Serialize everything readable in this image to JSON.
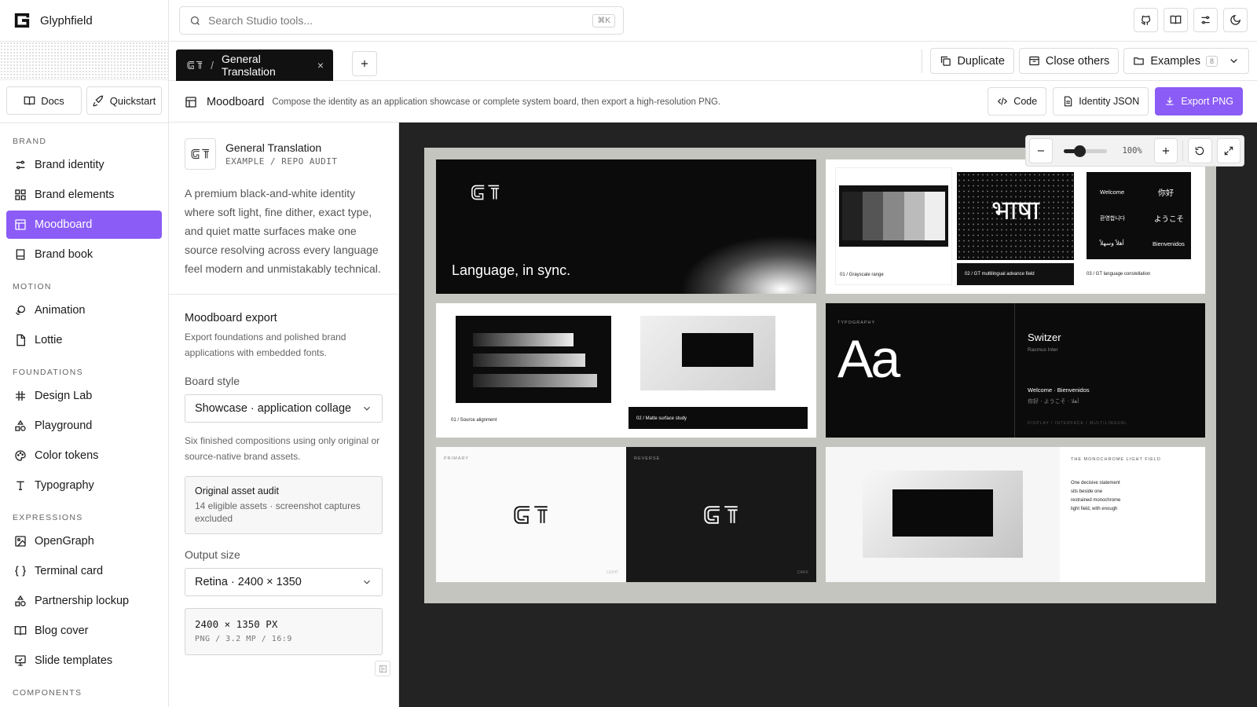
{
  "app": {
    "name": "Glyphfield"
  },
  "search": {
    "placeholder": "Search Studio tools...",
    "shortcut": "⌘K"
  },
  "sidebar": {
    "buttons": [
      {
        "label": "Docs",
        "icon": "book-icon"
      },
      {
        "label": "Quickstart",
        "icon": "rocket-icon"
      }
    ],
    "sections": [
      {
        "title": "BRAND",
        "items": [
          {
            "label": "Brand identity",
            "icon": "sliders-icon"
          },
          {
            "label": "Brand elements",
            "icon": "grid-icon"
          },
          {
            "label": "Moodboard",
            "icon": "layout-icon",
            "active": true
          },
          {
            "label": "Brand book",
            "icon": "book-icon"
          }
        ]
      },
      {
        "title": "MOTION",
        "items": [
          {
            "label": "Animation",
            "icon": "animation-icon"
          },
          {
            "label": "Lottie",
            "icon": "file-icon"
          }
        ]
      },
      {
        "title": "FOUNDATIONS",
        "items": [
          {
            "label": "Design Lab",
            "icon": "hash-icon"
          },
          {
            "label": "Playground",
            "icon": "shapes-icon"
          },
          {
            "label": "Color tokens",
            "icon": "palette-icon"
          },
          {
            "label": "Typography",
            "icon": "type-icon"
          }
        ]
      },
      {
        "title": "EXPRESSIONS",
        "items": [
          {
            "label": "OpenGraph",
            "icon": "image-icon"
          },
          {
            "label": "Terminal card",
            "icon": "braces-icon"
          },
          {
            "label": "Partnership lockup",
            "icon": "shapes-icon"
          },
          {
            "label": "Blog cover",
            "icon": "book-open-icon"
          },
          {
            "label": "Slide templates",
            "icon": "presentation-icon"
          }
        ]
      },
      {
        "title": "COMPONENTS",
        "items": []
      }
    ]
  },
  "tabs": {
    "active": {
      "prefix": "/",
      "label": "General Translation",
      "close": "×"
    }
  },
  "tab_actions": {
    "duplicate": "Duplicate",
    "close_others": "Close others",
    "examples": "Examples",
    "examples_count": "8"
  },
  "page": {
    "title": "Moodboard",
    "description": "Compose the identity as an application showcase or complete system board, then export a high-resolution PNG.",
    "buttons": {
      "code": "Code",
      "identity_json": "Identity JSON",
      "export": "Export PNG"
    }
  },
  "panel": {
    "project_name": "General Translation",
    "project_sub": "EXAMPLE / REPO AUDIT",
    "project_desc": "A premium black-and-white identity where soft light, fine dither, exact type, and quiet matte surfaces make one source resolving across every language feel modern and unmistakably technical.",
    "export_title": "Moodboard export",
    "export_desc": "Export foundations and polished brand applications with embedded fonts.",
    "board_style_label": "Board style",
    "board_style_value": "Showcase · application collage",
    "board_style_hint": "Six finished compositions using only original or source-native brand assets.",
    "audit_title": "Original asset audit",
    "audit_text": "14 eligible assets · screenshot captures excluded",
    "output_label": "Output size",
    "output_value": "Retina · 2400 × 1350",
    "output_dims": "2400 × 1350 PX",
    "output_meta": "PNG / 3.2 MP / 16:9"
  },
  "zoom": {
    "label": "100%",
    "level": 0.35
  },
  "board": {
    "hero": {
      "tagline": "Language, in sync."
    },
    "captions": {
      "grayscale": "01 / Grayscale range",
      "multilingual": "02 / GT multilingual advance field",
      "constellation": "03 / GT language constellation",
      "source": "01 / Source alignment",
      "matte": "02 / Matte surface study"
    },
    "devanagari": "भाषा",
    "greetings": [
      "Welcome",
      "你好",
      "환영합니다",
      "ようこそ",
      "أهلاً وسهلاً",
      "Bienvenidos"
    ],
    "typography": {
      "label": "TYPOGRAPHY",
      "specimen": "Aa",
      "font": "Switzer",
      "font_sub": "Rasmus Inter",
      "sample1": "Welcome · Bienvenidos",
      "sample2": "你好 · ようこそ · أهلا",
      "footer": "DISPLAY / INTERFACE / MULTILINGUAL"
    },
    "primary": {
      "label": "PRIMARY",
      "tag": "LIGHT"
    },
    "reverse": {
      "label": "REVERSE",
      "tag": "DARK"
    },
    "monochrome": {
      "title": "THE MONOCHROME LIGHT FIELD",
      "body": [
        "One decisive statement",
        "sits beside one",
        "restrained monochrome",
        "light field, with enough"
      ]
    }
  }
}
